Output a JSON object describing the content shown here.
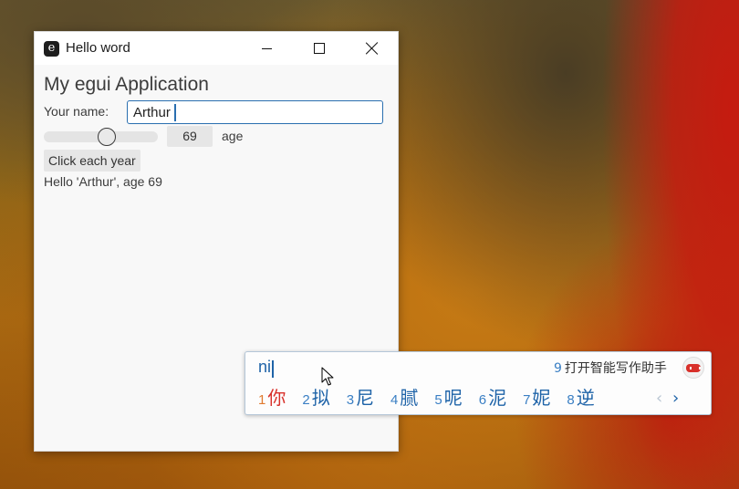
{
  "window": {
    "title": "Hello word",
    "app_icon_glyph": "e",
    "controls": {
      "minimize": "minimize-icon",
      "maximize": "maximize-icon",
      "close": "close-icon"
    }
  },
  "app": {
    "heading": "My egui Application",
    "name_label": "Your name:",
    "name_value": "Arthur",
    "age_value": "69",
    "age_slider_fraction": 0.56,
    "age_label": "age",
    "year_button": "Click each year",
    "greeting": "Hello 'Arthur', age 69"
  },
  "ime": {
    "composition": "ni",
    "assistant_number": "9",
    "assistant_label": "打开智能写作助手",
    "candidates": [
      {
        "num": "1",
        "char": "你"
      },
      {
        "num": "2",
        "char": "拟"
      },
      {
        "num": "3",
        "char": "尼"
      },
      {
        "num": "4",
        "char": "腻"
      },
      {
        "num": "5",
        "char": "呢"
      },
      {
        "num": "6",
        "char": "泥"
      },
      {
        "num": "7",
        "char": "妮"
      },
      {
        "num": "8",
        "char": "逆"
      }
    ],
    "prev_glyph": "‹",
    "next_glyph": "›"
  },
  "colors": {
    "accent": "#2a6fb0",
    "ime_blue": "#1e63a8",
    "ime_selected": "#d8302a"
  }
}
